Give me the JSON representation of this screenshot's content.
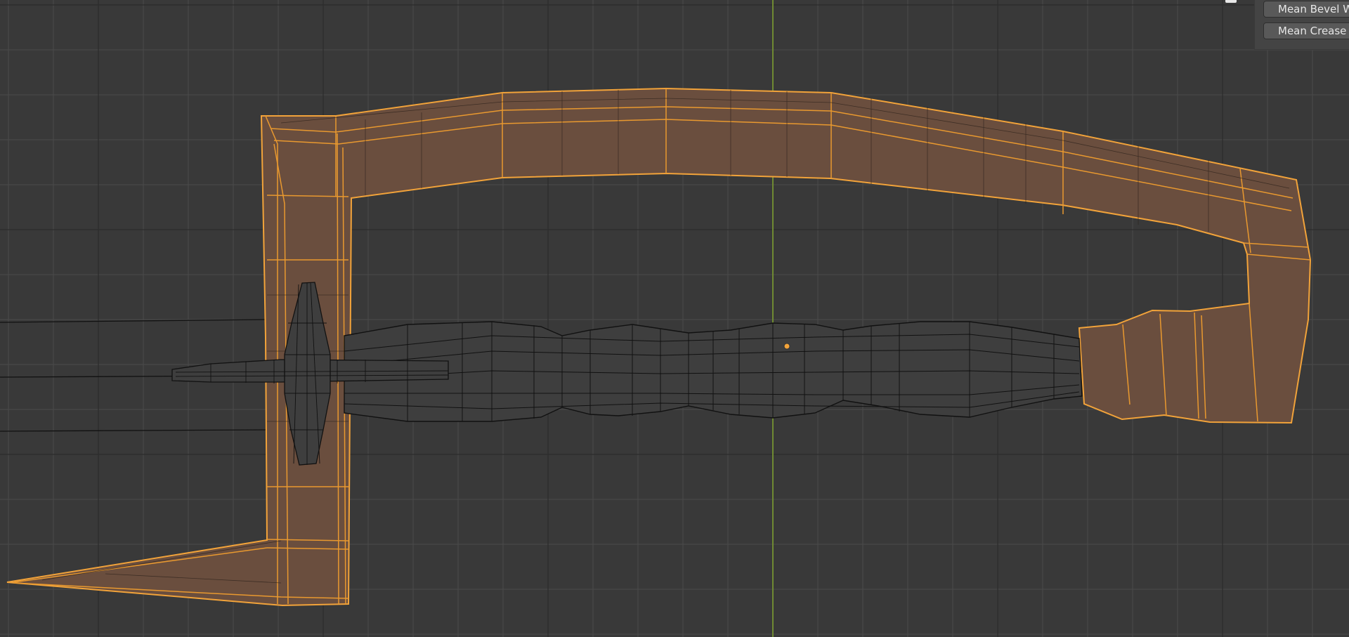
{
  "panel": {
    "buttons": [
      {
        "label": "Mean Bevel Weight"
      },
      {
        "label": "Mean Crease"
      }
    ]
  },
  "colors": {
    "background": "#393939",
    "grid_minor": "#444444",
    "grid_major": "#2e2e2e",
    "y_axis": "#6f8a32",
    "selected_edge": "#f2a33a",
    "selected_face": "#6a4e3e",
    "unselected_wire": "#111111",
    "unselected_face": "#3e3e3e"
  },
  "icons": [
    "panel-corner-handle-icon"
  ]
}
